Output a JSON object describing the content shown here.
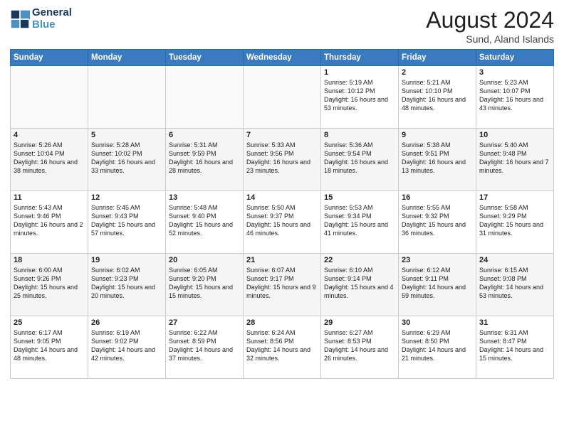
{
  "header": {
    "logo_general": "General",
    "logo_blue": "Blue",
    "month_year": "August 2024",
    "location": "Sund, Aland Islands"
  },
  "weekdays": [
    "Sunday",
    "Monday",
    "Tuesday",
    "Wednesday",
    "Thursday",
    "Friday",
    "Saturday"
  ],
  "weeks": [
    [
      {
        "day": "",
        "text": ""
      },
      {
        "day": "",
        "text": ""
      },
      {
        "day": "",
        "text": ""
      },
      {
        "day": "",
        "text": ""
      },
      {
        "day": "1",
        "text": "Sunrise: 5:19 AM\nSunset: 10:12 PM\nDaylight: 16 hours and 53 minutes."
      },
      {
        "day": "2",
        "text": "Sunrise: 5:21 AM\nSunset: 10:10 PM\nDaylight: 16 hours and 48 minutes."
      },
      {
        "day": "3",
        "text": "Sunrise: 5:23 AM\nSunset: 10:07 PM\nDaylight: 16 hours and 43 minutes."
      }
    ],
    [
      {
        "day": "4",
        "text": "Sunrise: 5:26 AM\nSunset: 10:04 PM\nDaylight: 16 hours and 38 minutes."
      },
      {
        "day": "5",
        "text": "Sunrise: 5:28 AM\nSunset: 10:02 PM\nDaylight: 16 hours and 33 minutes."
      },
      {
        "day": "6",
        "text": "Sunrise: 5:31 AM\nSunset: 9:59 PM\nDaylight: 16 hours and 28 minutes."
      },
      {
        "day": "7",
        "text": "Sunrise: 5:33 AM\nSunset: 9:56 PM\nDaylight: 16 hours and 23 minutes."
      },
      {
        "day": "8",
        "text": "Sunrise: 5:36 AM\nSunset: 9:54 PM\nDaylight: 16 hours and 18 minutes."
      },
      {
        "day": "9",
        "text": "Sunrise: 5:38 AM\nSunset: 9:51 PM\nDaylight: 16 hours and 13 minutes."
      },
      {
        "day": "10",
        "text": "Sunrise: 5:40 AM\nSunset: 9:48 PM\nDaylight: 16 hours and 7 minutes."
      }
    ],
    [
      {
        "day": "11",
        "text": "Sunrise: 5:43 AM\nSunset: 9:46 PM\nDaylight: 16 hours and 2 minutes."
      },
      {
        "day": "12",
        "text": "Sunrise: 5:45 AM\nSunset: 9:43 PM\nDaylight: 15 hours and 57 minutes."
      },
      {
        "day": "13",
        "text": "Sunrise: 5:48 AM\nSunset: 9:40 PM\nDaylight: 15 hours and 52 minutes."
      },
      {
        "day": "14",
        "text": "Sunrise: 5:50 AM\nSunset: 9:37 PM\nDaylight: 15 hours and 46 minutes."
      },
      {
        "day": "15",
        "text": "Sunrise: 5:53 AM\nSunset: 9:34 PM\nDaylight: 15 hours and 41 minutes."
      },
      {
        "day": "16",
        "text": "Sunrise: 5:55 AM\nSunset: 9:32 PM\nDaylight: 15 hours and 36 minutes."
      },
      {
        "day": "17",
        "text": "Sunrise: 5:58 AM\nSunset: 9:29 PM\nDaylight: 15 hours and 31 minutes."
      }
    ],
    [
      {
        "day": "18",
        "text": "Sunrise: 6:00 AM\nSunset: 9:26 PM\nDaylight: 15 hours and 25 minutes."
      },
      {
        "day": "19",
        "text": "Sunrise: 6:02 AM\nSunset: 9:23 PM\nDaylight: 15 hours and 20 minutes."
      },
      {
        "day": "20",
        "text": "Sunrise: 6:05 AM\nSunset: 9:20 PM\nDaylight: 15 hours and 15 minutes."
      },
      {
        "day": "21",
        "text": "Sunrise: 6:07 AM\nSunset: 9:17 PM\nDaylight: 15 hours and 9 minutes."
      },
      {
        "day": "22",
        "text": "Sunrise: 6:10 AM\nSunset: 9:14 PM\nDaylight: 15 hours and 4 minutes."
      },
      {
        "day": "23",
        "text": "Sunrise: 6:12 AM\nSunset: 9:11 PM\nDaylight: 14 hours and 59 minutes."
      },
      {
        "day": "24",
        "text": "Sunrise: 6:15 AM\nSunset: 9:08 PM\nDaylight: 14 hours and 53 minutes."
      }
    ],
    [
      {
        "day": "25",
        "text": "Sunrise: 6:17 AM\nSunset: 9:05 PM\nDaylight: 14 hours and 48 minutes."
      },
      {
        "day": "26",
        "text": "Sunrise: 6:19 AM\nSunset: 9:02 PM\nDaylight: 14 hours and 42 minutes."
      },
      {
        "day": "27",
        "text": "Sunrise: 6:22 AM\nSunset: 8:59 PM\nDaylight: 14 hours and 37 minutes."
      },
      {
        "day": "28",
        "text": "Sunrise: 6:24 AM\nSunset: 8:56 PM\nDaylight: 14 hours and 32 minutes."
      },
      {
        "day": "29",
        "text": "Sunrise: 6:27 AM\nSunset: 8:53 PM\nDaylight: 14 hours and 26 minutes."
      },
      {
        "day": "30",
        "text": "Sunrise: 6:29 AM\nSunset: 8:50 PM\nDaylight: 14 hours and 21 minutes."
      },
      {
        "day": "31",
        "text": "Sunrise: 6:31 AM\nSunset: 8:47 PM\nDaylight: 14 hours and 15 minutes."
      }
    ]
  ]
}
